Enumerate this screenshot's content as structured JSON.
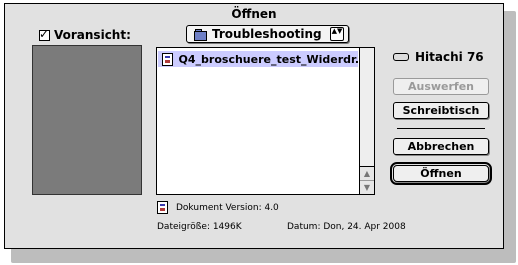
{
  "dialog": {
    "title": "Öffnen",
    "preview": {
      "label": "Voransicht:",
      "checked": true,
      "checkmark": "✓"
    },
    "location_popup": {
      "label": "Troubleshooting",
      "icon": "folder-icon",
      "arrows": "▲▼"
    },
    "file_list": {
      "items": [
        {
          "name": "Q4_broschuere_test_Widerdr...",
          "icon": "document-icon",
          "selected": true
        }
      ],
      "scroll_up": "▲",
      "scroll_down": "▼"
    },
    "volume": {
      "name": "Hitachi 76",
      "icon": "drive-icon"
    },
    "buttons": {
      "eject": "Auswerfen",
      "desktop": "Schreibtisch",
      "cancel": "Abbrechen",
      "open": "Öffnen"
    },
    "info": {
      "kind": "Dokument Version: 4.0",
      "size": "Dateigröße: 1496K",
      "date": "Datum: Don, 24. Apr 2008"
    }
  },
  "colors": {
    "selection": "#ccccff",
    "dialog_bg": "#e1e1e1",
    "preview_bg": "#7b7b7b"
  }
}
